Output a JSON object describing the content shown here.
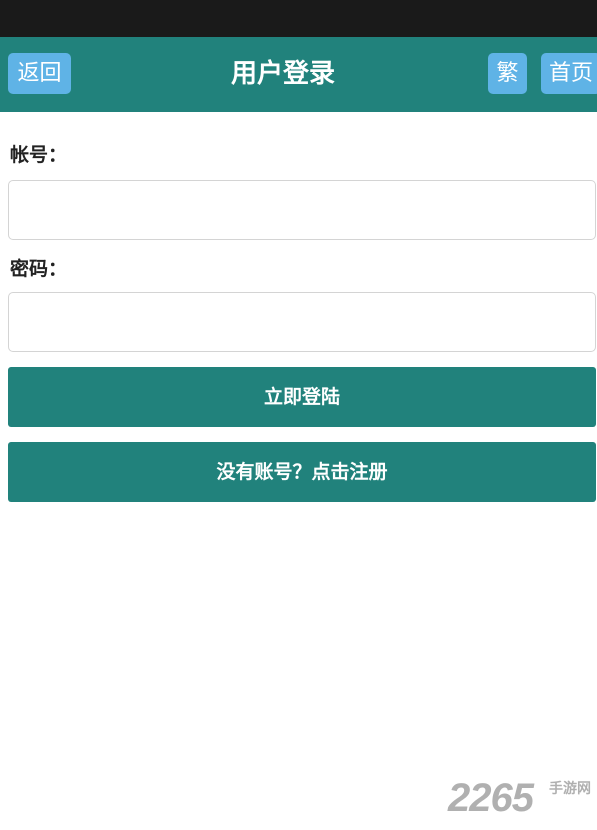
{
  "header": {
    "back_label": "返回",
    "title": "用户登录",
    "traditional_label": "繁",
    "home_label": "首页"
  },
  "form": {
    "account_label": "帐号：",
    "account_value": "",
    "password_label": "密码：",
    "password_value": "",
    "login_button": "立即登陆",
    "register_button": "没有账号？点击注册"
  },
  "watermark": {
    "number": "2265",
    "text": "手游网"
  },
  "colors": {
    "status_bar": "#1a1a1a",
    "header_bg": "#21827c",
    "header_button": "#5fb3e6",
    "primary_button": "#21827c"
  }
}
